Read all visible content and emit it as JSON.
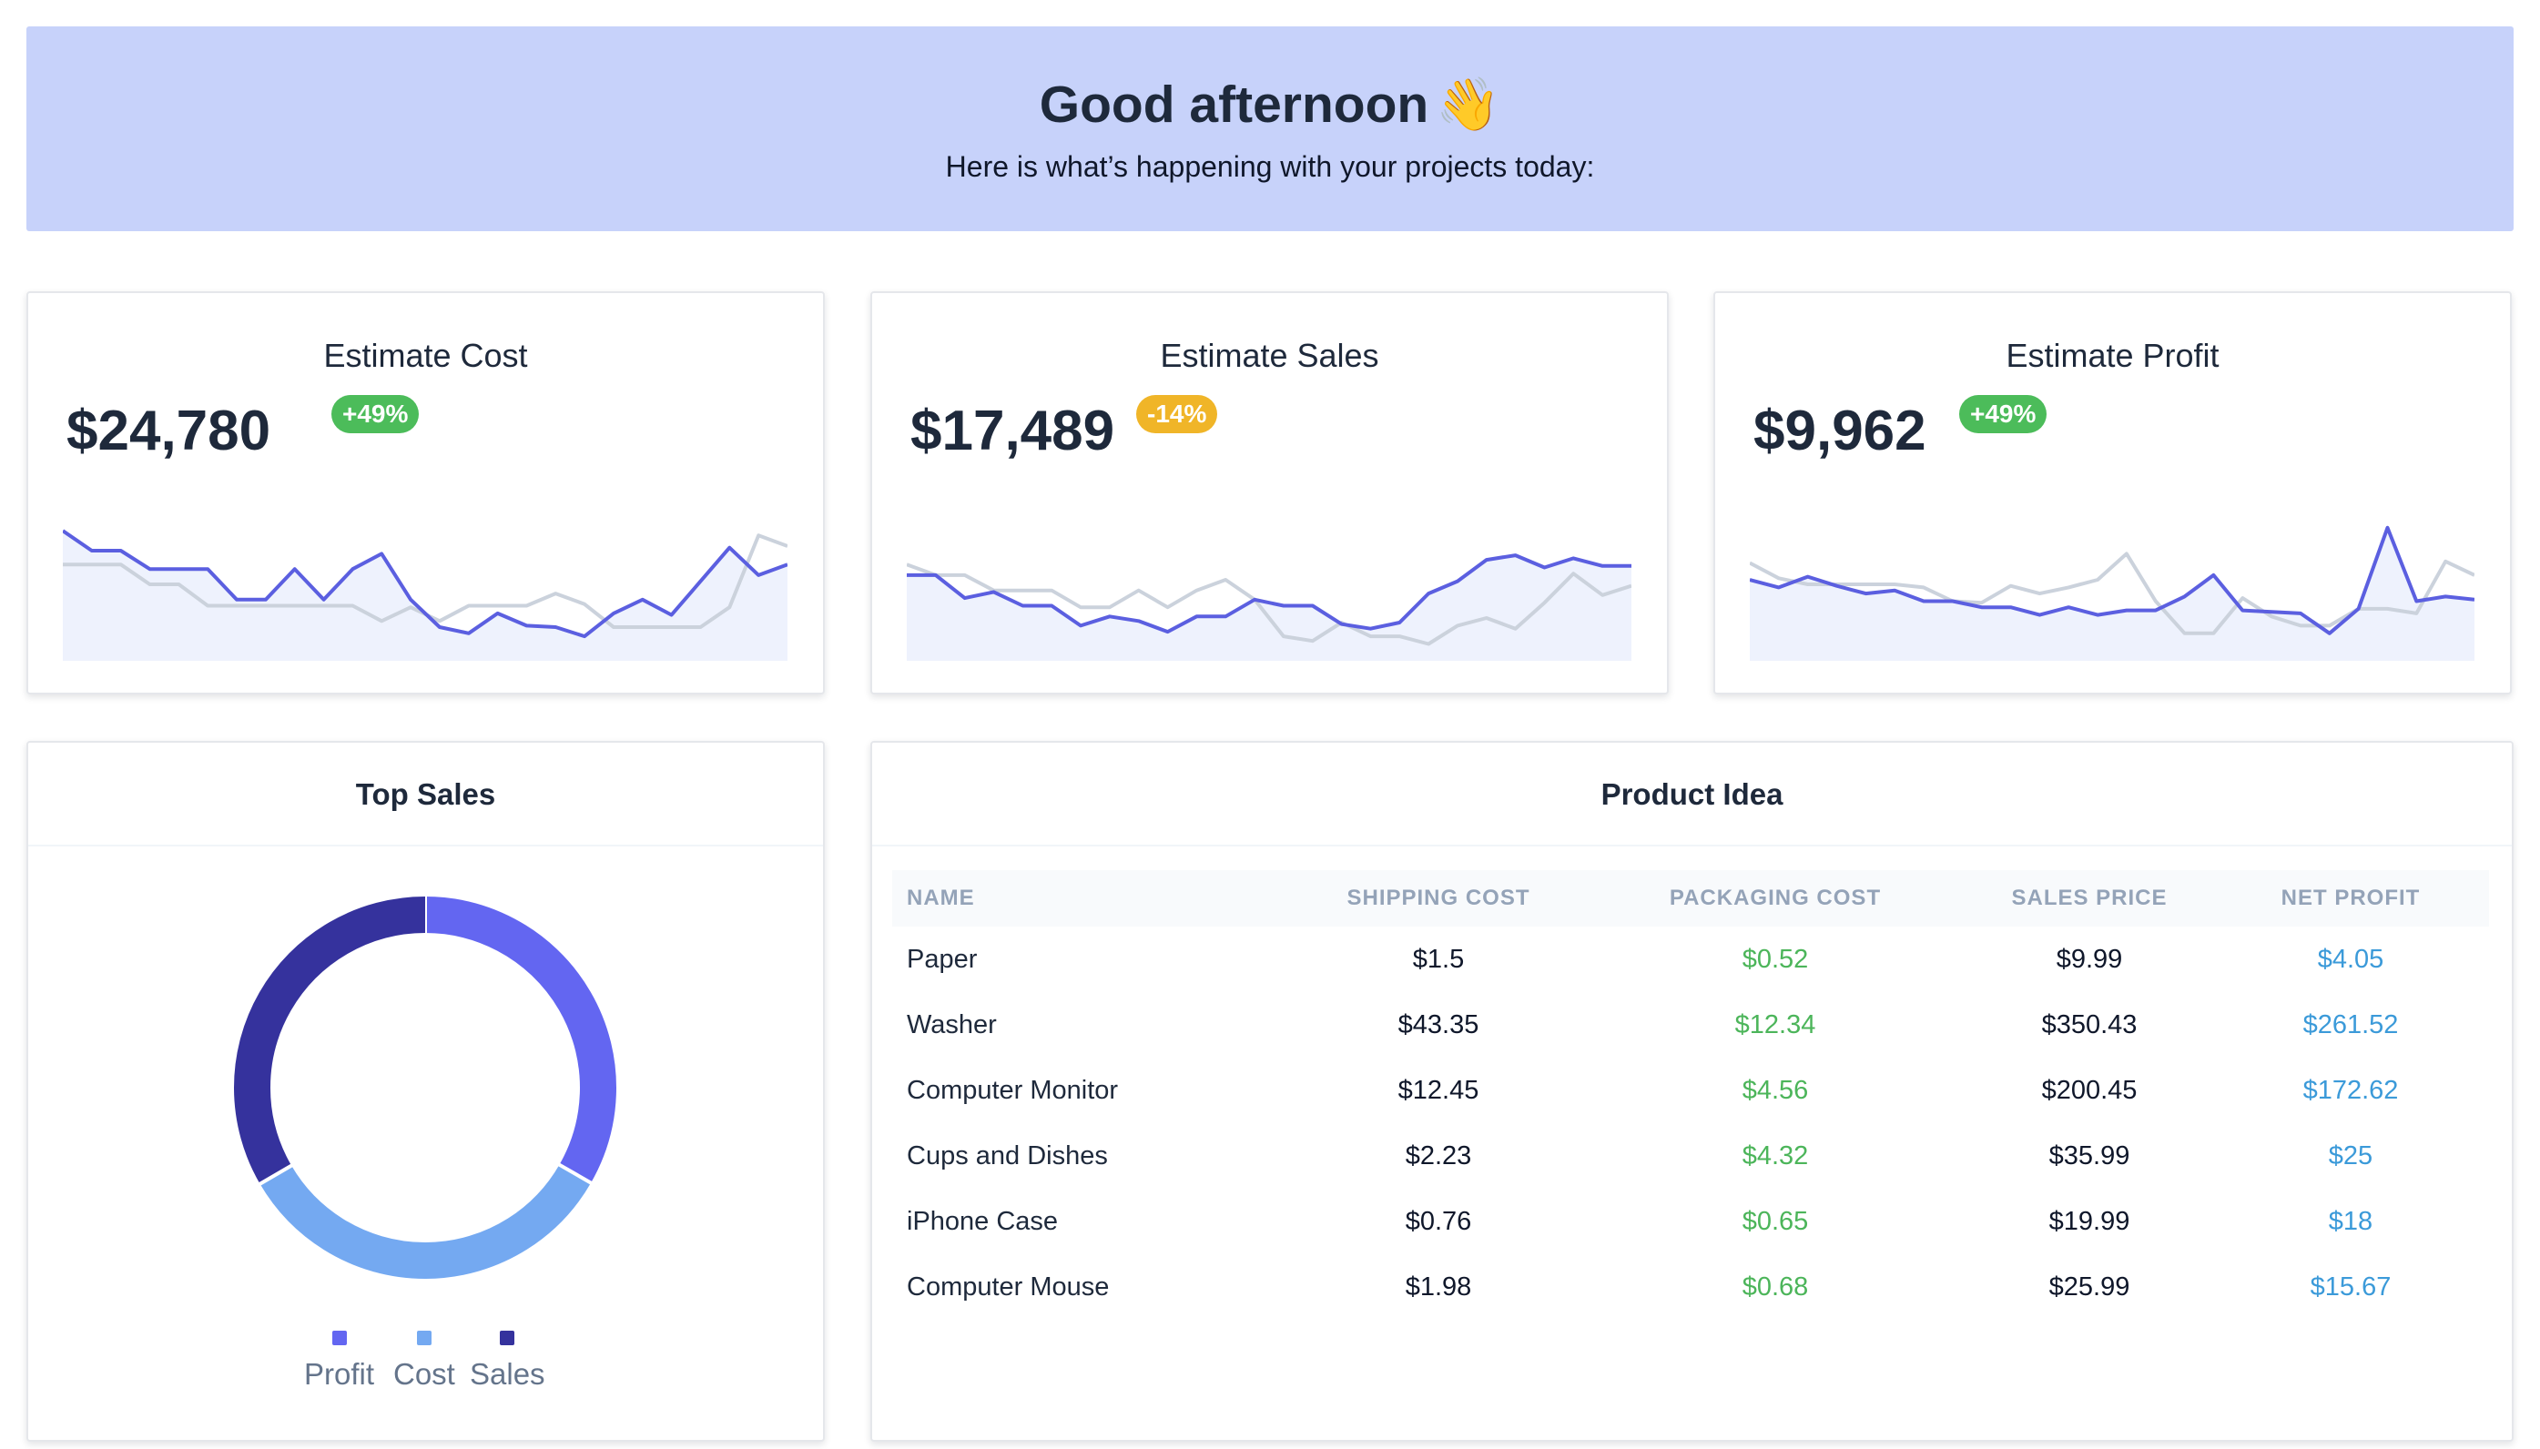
{
  "banner": {
    "title": "Good afternoon",
    "subtitle": "Here is what’s happening with your projects today:"
  },
  "kpis": [
    {
      "title": "Estimate Cost",
      "value": "$24,780",
      "badge": "+49%",
      "badge_color": "#4cbc5a",
      "chart_data": {
        "type": "line",
        "series": [
          {
            "color": "#5b5fe0",
            "values": [
              8.5,
              7.2,
              7.2,
              6.0,
              6.0,
              6.0,
              4.0,
              4.0,
              6.0,
              4.0,
              6.0,
              7.0,
              4.0,
              2.2,
              1.8,
              3.1,
              2.3,
              2.2,
              1.6,
              3.1,
              4.0,
              3.0,
              5.2,
              7.4,
              5.6,
              6.3
            ]
          },
          {
            "color": "#cbd2dc",
            "values": [
              6.3,
              6.3,
              6.3,
              5.0,
              5.0,
              3.6,
              3.6,
              3.6,
              3.6,
              3.6,
              3.6,
              2.6,
              3.5,
              2.6,
              3.6,
              3.6,
              3.6,
              4.4,
              3.7,
              2.2,
              2.2,
              2.2,
              2.2,
              3.5,
              8.2,
              7.5
            ]
          }
        ]
      }
    },
    {
      "title": "Estimate Sales",
      "value": "$17,489",
      "badge": "-14%",
      "badge_color": "#f0b528",
      "chart_data": {
        "type": "line",
        "series": [
          {
            "color": "#5b5fe0",
            "values": [
              5.6,
              5.6,
              4.1,
              4.5,
              3.6,
              3.6,
              2.3,
              2.9,
              2.6,
              1.9,
              2.9,
              2.9,
              4.0,
              3.6,
              3.6,
              2.4,
              2.1,
              2.5,
              4.4,
              5.2,
              6.6,
              6.9,
              6.1,
              6.7,
              6.2,
              6.2
            ]
          },
          {
            "color": "#cbd2dc",
            "values": [
              6.3,
              5.6,
              5.6,
              4.6,
              4.6,
              4.6,
              3.5,
              3.5,
              4.6,
              3.5,
              4.6,
              5.3,
              4.0,
              1.6,
              1.3,
              2.5,
              1.6,
              1.6,
              1.1,
              2.3,
              2.8,
              2.1,
              3.8,
              5.7,
              4.3,
              4.9
            ]
          }
        ]
      }
    },
    {
      "title": "Estimate Profit",
      "value": "$9,962",
      "badge": "+49%",
      "badge_color": "#4cbc5a",
      "chart_data": {
        "type": "line",
        "series": [
          {
            "color": "#5b5fe0",
            "values": [
              5.3,
              4.8,
              5.5,
              4.9,
              4.4,
              4.6,
              3.9,
              3.9,
              3.5,
              3.5,
              3.0,
              3.5,
              3.0,
              3.3,
              3.3,
              4.2,
              5.6,
              3.3,
              3.2,
              3.1,
              1.8,
              3.4,
              8.7,
              3.9,
              4.2,
              4.0
            ]
          },
          {
            "color": "#cbd2dc",
            "values": [
              6.4,
              5.4,
              5.0,
              5.0,
              5.0,
              5.0,
              4.8,
              3.9,
              3.8,
              4.9,
              4.4,
              4.8,
              5.3,
              7.0,
              3.9,
              1.8,
              1.8,
              4.1,
              2.9,
              2.3,
              2.3,
              3.4,
              3.4,
              3.1,
              6.5,
              5.6
            ]
          }
        ]
      }
    }
  ],
  "top_sales": {
    "title": "Top Sales",
    "chart_data": {
      "type": "pie",
      "series": [
        {
          "name": "Profit",
          "value": 33.3,
          "color": "#6366f1"
        },
        {
          "name": "Cost",
          "value": 33.3,
          "color": "#74a9f1"
        },
        {
          "name": "Sales",
          "value": 33.4,
          "color": "#35329d"
        }
      ]
    }
  },
  "product_idea": {
    "title": "Product Idea",
    "columns": [
      "NAME",
      "SHIPPING COST",
      "PACKAGING COST",
      "SALES PRICE",
      "NET PROFIT"
    ],
    "rows": [
      [
        "Paper",
        "$1.5",
        "$0.52",
        "$9.99",
        "$4.05"
      ],
      [
        "Washer",
        "$43.35",
        "$12.34",
        "$350.43",
        "$261.52"
      ],
      [
        "Computer Monitor",
        "$12.45",
        "$4.56",
        "$200.45",
        "$172.62"
      ],
      [
        "Cups and Dishes",
        "$2.23",
        "$4.32",
        "$35.99",
        "$25"
      ],
      [
        "iPhone Case",
        "$0.76",
        "$0.65",
        "$19.99",
        "$18"
      ],
      [
        "Computer Mouse",
        "$1.98",
        "$0.68",
        "$25.99",
        "$15.67"
      ]
    ]
  }
}
